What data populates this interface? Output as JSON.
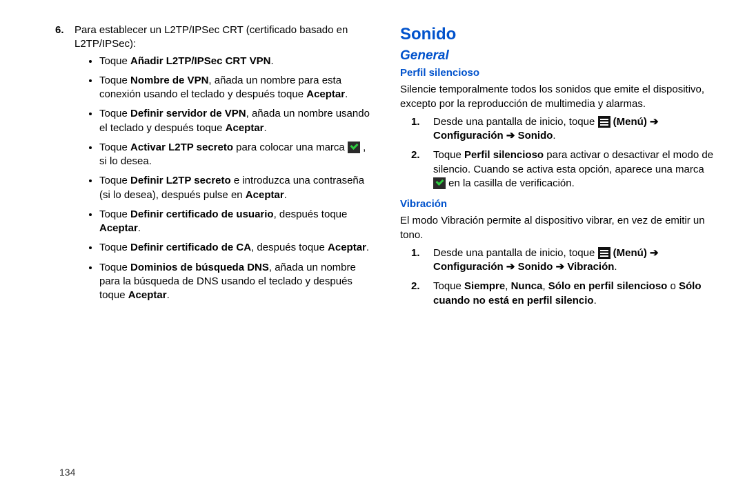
{
  "left": {
    "step6_num": "6.",
    "step6_lead": "Para establecer un L2TP/IPSec CRT (certificado basado en L2TP/IPSec):",
    "b1_pre": "Toque ",
    "b1_bold": "Añadir L2TP/IPSec CRT VPN",
    "b1_post": ".",
    "b2_pre": "Toque ",
    "b2_bold1": "Nombre de VPN",
    "b2_mid": ", añada un nombre para esta conexión usando el teclado y después toque ",
    "b2_bold2": "Aceptar",
    "b2_post": ".",
    "b3_pre": "Toque ",
    "b3_bold1": "Definir servidor de VPN",
    "b3_mid": ", añada un nombre usando el teclado y después toque ",
    "b3_bold2": "Aceptar",
    "b3_post": ".",
    "b4_pre": "Toque ",
    "b4_bold1": "Activar L2TP secreto",
    "b4_mid_a": " para colocar una marca ",
    "b4_mid_b": " , si lo desea.",
    "b5_pre": "Toque ",
    "b5_bold1": "Definir L2TP secreto",
    "b5_mid": " e introduzca una contraseña (si lo desea), después pulse en ",
    "b5_bold2": "Aceptar",
    "b5_post": ".",
    "b6_pre": "Toque ",
    "b6_bold1": "Definir certificado de usuario",
    "b6_mid": ", después toque ",
    "b6_bold2": "Aceptar",
    "b6_post": ".",
    "b7_pre": "Toque ",
    "b7_bold1": "Definir certificado de CA",
    "b7_mid": ", después toque ",
    "b7_bold2": "Aceptar",
    "b7_post": ".",
    "b8_pre": "Toque ",
    "b8_bold1": "Dominios de búsqueda DNS",
    "b8_mid": ", añada un nombre para la búsqueda de DNS usando el teclado y después toque ",
    "b8_bold2": "Aceptar",
    "b8_post": "."
  },
  "right": {
    "h1": "Sonido",
    "h2": "General",
    "sec1_h3": "Perfil silencioso",
    "sec1_para": "Silencie temporalmente todos los sonidos que emite el dispositivo, excepto por la reproducción de multimedia y alarmas.",
    "sec1_s1_a": "Desde una pantalla de inicio, toque ",
    "sec1_s1_menu": " (Menú) ",
    "sec1_s1_b": "Configuración ",
    "sec1_s1_c": " Sonido",
    "sec1_s1_dot": ".",
    "sec1_s2_a": "Toque ",
    "sec1_s2_bold": "Perfil silencioso",
    "sec1_s2_b": " para activar o desactivar el modo de silencio. Cuando se activa esta opción, aparece una marca ",
    "sec1_s2_c": " en la casilla de verificación.",
    "sec2_h3": "Vibración",
    "sec2_para": "El modo Vibración permite al dispositivo vibrar, en vez de emitir un tono.",
    "sec2_s1_a": "Desde una pantalla de inicio, toque ",
    "sec2_s1_menu": " (Menú) ",
    "sec2_s1_b": "Configuración ",
    "sec2_s1_c": " Sonido ",
    "sec2_s1_d": " Vibración",
    "sec2_s1_dot": ".",
    "sec2_s2_a": "Toque ",
    "sec2_s2_b1": "Siempre",
    "sec2_s2_c1": ", ",
    "sec2_s2_b2": "Nunca",
    "sec2_s2_c2": ", ",
    "sec2_s2_b3": "Sólo en perfil silencioso",
    "sec2_s2_c3": " o ",
    "sec2_s2_b4": "Sólo cuando no está en perfil silencio",
    "sec2_s2_dot": "."
  },
  "arrow": "➔",
  "page_number": "134"
}
